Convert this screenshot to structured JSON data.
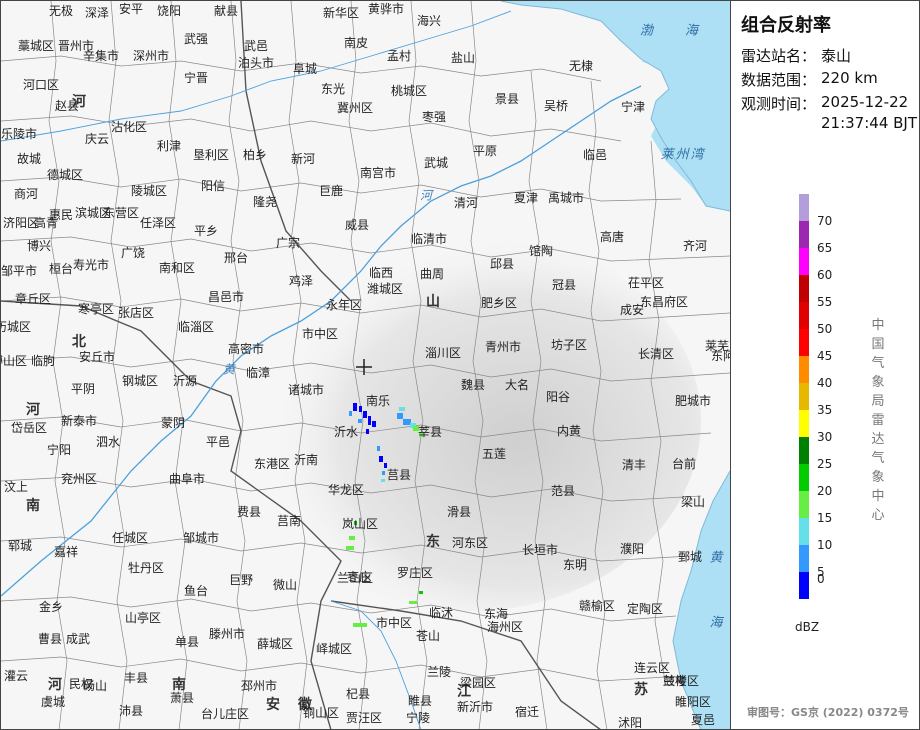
{
  "panel": {
    "title": "组合反射率",
    "station_label": "雷达站名：",
    "station_value": "泰山",
    "range_label": "数据范围：",
    "range_value": "220 km",
    "time_label": "观测时间：",
    "time_date": "2025-12-22",
    "time_clock": "21:37:44 BJT"
  },
  "legend": {
    "unit": "dBZ",
    "ticks": [
      "70",
      "65",
      "60",
      "55",
      "50",
      "45",
      "40",
      "35",
      "30",
      "25",
      "20",
      "15",
      "10",
      "5",
      "0"
    ],
    "colors": [
      "#b39ddb",
      "#9c27b0",
      "#ff00ff",
      "#c00000",
      "#e00000",
      "#ff0000",
      "#ff8c00",
      "#e6b800",
      "#ffff00",
      "#008000",
      "#00cc00",
      "#66ee44",
      "#66e0e8",
      "#3399ff",
      "#0000ff"
    ]
  },
  "organization": "中国气象局雷达气象中心",
  "review_number": "审图号：GS京 (2022) 0372号",
  "map": {
    "colors": {
      "sea": "#aee0f5",
      "land": "#f6f6f6",
      "border": "#777777",
      "river": "#4ea0dc"
    },
    "sea_labels": [
      "渤 海",
      "莱州湾",
      "黄",
      "海"
    ],
    "province_labels": [
      "河",
      "北",
      "河",
      "南",
      "山",
      "东",
      "江",
      "苏",
      "安",
      "徽",
      "河",
      "南"
    ],
    "river_labels": [
      "河",
      "黄"
    ],
    "places": [
      "无极",
      "深泽",
      "安平",
      "饶阳",
      "献县",
      "新华区",
      "黄骅市",
      "海兴",
      "藁城区",
      "晋州市",
      "辛集市",
      "深州市",
      "武强",
      "泊头市",
      "南皮",
      "孟村",
      "盐山",
      "无棣",
      "河口区",
      "赵县",
      "宁晋",
      "武邑",
      "阜城",
      "东光",
      "冀州区",
      "桃城区",
      "景县",
      "吴桥",
      "宁津",
      "乐陵市",
      "庆云",
      "沾化区",
      "利津",
      "垦利区",
      "柏乡",
      "新河",
      "枣强",
      "故城",
      "德城区",
      "陵城区",
      "阳信",
      "隆尧",
      "巨鹿",
      "南宫市",
      "武城",
      "平原",
      "临邑",
      "商河",
      "惠民",
      "滨城区",
      "东营区",
      "任泽区",
      "平乡",
      "广宗",
      "威县",
      "清河",
      "夏津",
      "禹城市",
      "济阳区",
      "高青",
      "博兴",
      "广饶",
      "南和区",
      "邢台",
      "鸡泽",
      "临西",
      "临清市",
      "高唐",
      "齐河",
      "邹平市",
      "桓台",
      "寿光市",
      "寒亭区",
      "昌邑市",
      "永年区",
      "曲周",
      "邱县",
      "馆陶",
      "茌平区",
      "章丘区",
      "张店区",
      "临淄区",
      "潍城区",
      "肥乡区",
      "冠县",
      "东昌府区",
      "历城区",
      "市中区",
      "淄川区",
      "青州市",
      "坊子区",
      "成安",
      "长清区",
      "莱芜区",
      "博山区",
      "临朐",
      "安丘市",
      "高密市",
      "临漳",
      "魏县",
      "大名",
      "东阿",
      "平阴",
      "钢城区",
      "沂源",
      "诸城市",
      "南乐",
      "莘县",
      "阳谷",
      "肥城市",
      "岱岳区",
      "新泰市",
      "蒙阴",
      "沂水",
      "莒县",
      "五莲",
      "内黄",
      "清丰",
      "台前",
      "宁阳",
      "泗水",
      "平邑",
      "沂南",
      "东港区",
      "华龙区",
      "范县",
      "梁山",
      "汶上",
      "兖州区",
      "曲阜市",
      "费县",
      "莒南",
      "岚山区",
      "滑县",
      "濮阳",
      "鄄城",
      "郓城",
      "嘉祥",
      "任城区",
      "邹城市",
      "兰山区",
      "河东区",
      "长垣市",
      "东明",
      "牡丹区",
      "巨野",
      "微山",
      "枣庄",
      "罗庄区",
      "临沭",
      "赣榆区",
      "定陶区",
      "金乡",
      "鱼台",
      "滕州市",
      "山亭区",
      "市中区",
      "苍山",
      "东海",
      "海州区",
      "连云区",
      "兰考",
      "曹县",
      "成武",
      "单县",
      "薛城区",
      "峄城区",
      "兰陵",
      "新沂市",
      "灌云",
      "民权",
      "丰县",
      "沛县",
      "台儿庄区",
      "邳州市",
      "杞县",
      "睢县",
      "宁陵",
      "梁园区",
      "虞城",
      "砀山",
      "萧县",
      "铜山区",
      "贾汪区",
      "宿迁",
      "沭阳",
      "睢阳区",
      "夏邑",
      "鼓楼区",
      "泉山区",
      "睢宁"
    ]
  },
  "echoes": [
    {
      "lon": 117.05,
      "lat": 36.18,
      "dbz": 5
    },
    {
      "lon": 117.1,
      "lat": 36.1,
      "dbz": 10
    }
  ]
}
